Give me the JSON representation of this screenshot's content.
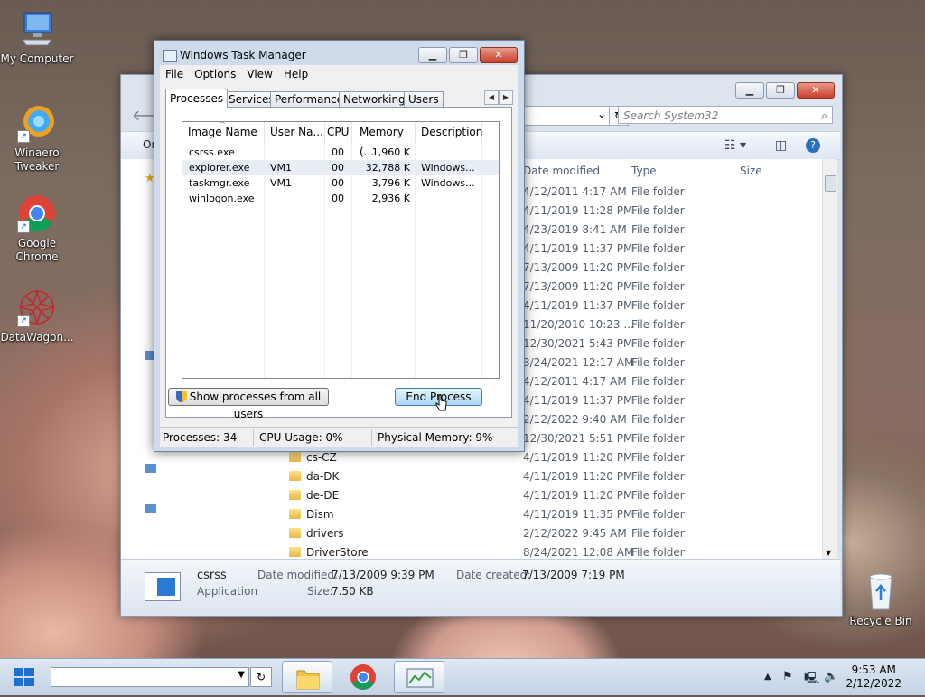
{
  "desktop": {
    "icons": [
      {
        "label": "My Computer"
      },
      {
        "label": "Winaero Tweaker"
      },
      {
        "label": "Google Chrome"
      },
      {
        "label": "DataWagon..."
      },
      {
        "label": "Recycle Bin"
      }
    ]
  },
  "explorer": {
    "search_placeholder": "Search System32",
    "organize": "Or",
    "columns": {
      "date": "Date modified",
      "type": "Type",
      "size": "Size"
    },
    "rows": [
      {
        "name": "",
        "date": "4/12/2011 4:17 AM",
        "type": "File folder"
      },
      {
        "name": "",
        "date": "4/11/2019 11:28 PM",
        "type": "File folder"
      },
      {
        "name": "",
        "date": "4/23/2019 8:41 AM",
        "type": "File folder"
      },
      {
        "name": "",
        "date": "4/11/2019 11:37 PM",
        "type": "File folder"
      },
      {
        "name": "",
        "date": "7/13/2009 11:20 PM",
        "type": "File folder"
      },
      {
        "name": "",
        "date": "7/13/2009 11:20 PM",
        "type": "File folder"
      },
      {
        "name": "",
        "date": "4/11/2019 11:37 PM",
        "type": "File folder"
      },
      {
        "name": "",
        "date": "11/20/2010 10:23 ...",
        "type": "File folder"
      },
      {
        "name": "",
        "date": "12/30/2021 5:43 PM",
        "type": "File folder"
      },
      {
        "name": "",
        "date": "3/24/2021 12:17 AM",
        "type": "File folder"
      },
      {
        "name": "",
        "date": "4/12/2011 4:17 AM",
        "type": "File folder"
      },
      {
        "name": "",
        "date": "4/11/2019 11:37 PM",
        "type": "File folder"
      },
      {
        "name": "",
        "date": "2/12/2022 9:40 AM",
        "type": "File folder"
      },
      {
        "name": "",
        "date": "12/30/2021 5:51 PM",
        "type": "File folder"
      },
      {
        "name": "cs-CZ",
        "date": "4/11/2019 11:20 PM",
        "type": "File folder"
      },
      {
        "name": "da-DK",
        "date": "4/11/2019 11:20 PM",
        "type": "File folder"
      },
      {
        "name": "de-DE",
        "date": "4/11/2019 11:20 PM",
        "type": "File folder"
      },
      {
        "name": "Dism",
        "date": "4/11/2019 11:35 PM",
        "type": "File folder"
      },
      {
        "name": "drivers",
        "date": "2/12/2022 9:45 AM",
        "type": "File folder"
      },
      {
        "name": "DriverStore",
        "date": "8/24/2021 12:08 AM",
        "type": "File folder"
      }
    ],
    "details": {
      "name": "csrss",
      "kind": "Application",
      "modified_label": "Date modified:",
      "modified": "7/13/2009 9:39 PM",
      "created_label": "Date created:",
      "created": "7/13/2009 7:19 PM",
      "size_label": "Size:",
      "size": "7.50 KB"
    }
  },
  "taskmanager": {
    "title": "Windows Task Manager",
    "menu": [
      "File",
      "Options",
      "View",
      "Help"
    ],
    "tabs": [
      "Processes",
      "Services",
      "Performance",
      "Networking",
      "Users"
    ],
    "columns": [
      "Image Name",
      "User Na...",
      "CPU",
      "Memory (...",
      "Description"
    ],
    "processes": [
      {
        "image": "csrss.exe",
        "user": "",
        "cpu": "00",
        "memory": "1,960 K",
        "desc": ""
      },
      {
        "image": "explorer.exe",
        "user": "VM1",
        "cpu": "00",
        "memory": "32,788 K",
        "desc": "Windows..."
      },
      {
        "image": "taskmgr.exe",
        "user": "VM1",
        "cpu": "00",
        "memory": "3,796 K",
        "desc": "Windows..."
      },
      {
        "image": "winlogon.exe",
        "user": "",
        "cpu": "00",
        "memory": "2,936 K",
        "desc": ""
      }
    ],
    "show_all_label": "Show processes from all users",
    "end_process_label": "End Process",
    "status": {
      "processes": "Processes: 34",
      "cpu": "CPU Usage: 0%",
      "memory": "Physical Memory: 9%"
    }
  },
  "taskbar": {
    "time": "9:53 AM",
    "date": "2/12/2022"
  }
}
